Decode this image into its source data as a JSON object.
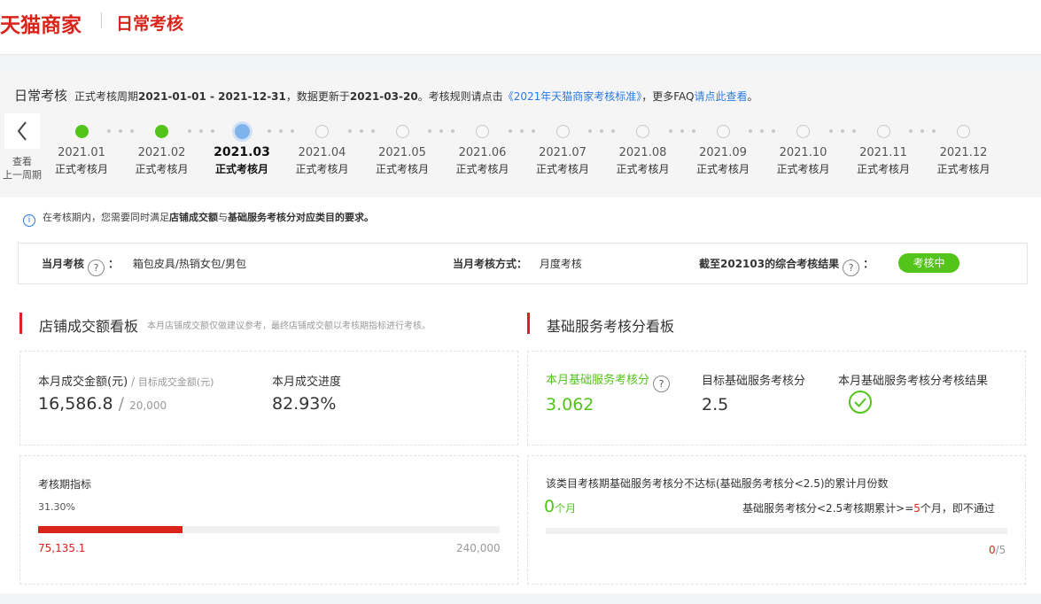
{
  "header": {
    "brand": "天猫商家",
    "title": "日常考核"
  },
  "period": {
    "title": "日常考核",
    "prefix": "正式考核周期",
    "range": "2021-01-01 - 2021-12-31",
    "update_prefix": "，数据更新于",
    "update_date": "2021-03-20",
    "rule_prefix": "。考核规则请点击",
    "rule_link": "《2021年天猫商家考核标准》",
    "faq_prefix": "，更多FAQ",
    "faq_link": "请点此查看",
    "end": "。"
  },
  "prev_button": {
    "label": "查看上一周期",
    "line1": "查看",
    "line2": "上一周期"
  },
  "months": [
    {
      "month": "2021.01",
      "status": "正式考核月",
      "state": "passed"
    },
    {
      "month": "2021.02",
      "status": "正式考核月",
      "state": "passed"
    },
    {
      "month": "2021.03",
      "status": "正式考核月",
      "state": "current"
    },
    {
      "month": "2021.04",
      "status": "正式考核月",
      "state": "future"
    },
    {
      "month": "2021.05",
      "status": "正式考核月",
      "state": "future"
    },
    {
      "month": "2021.06",
      "status": "正式考核月",
      "state": "future"
    },
    {
      "month": "2021.07",
      "status": "正式考核月",
      "state": "future"
    },
    {
      "month": "2021.08",
      "status": "正式考核月",
      "state": "future"
    },
    {
      "month": "2021.09",
      "status": "正式考核月",
      "state": "future"
    },
    {
      "month": "2021.10",
      "status": "正式考核月",
      "state": "future"
    },
    {
      "month": "2021.11",
      "status": "正式考核月",
      "state": "future"
    },
    {
      "month": "2021.12",
      "status": "正式考核月",
      "state": "future"
    }
  ],
  "info": {
    "icon": "i",
    "text1": "在考核期内，您需要同时满足",
    "bold1": "店铺成交额",
    "text2": "与",
    "bold2": "基础服务考核分对应类目的要求。"
  },
  "summary": {
    "month_label": "当月考核",
    "colon": "：",
    "category": "箱包皮具/热销女包/男包",
    "method_label": "当月考核方式：",
    "method": "月度考核",
    "result_label": "截至202103的综合考核结果",
    "result_badge": "考核中",
    "help_icon": "?"
  },
  "sales": {
    "title": "店铺成交额看板",
    "note": "本月店铺成交额仅做建议参考，最终店铺成交额以考核期指标进行考核。",
    "amount_label": "本月成交金额(元)",
    "slash": " / ",
    "target_label": "目标成交金额(元)",
    "amount": "16,586.8",
    "target": "20,000",
    "progress_label": "本月成交进度",
    "progress": "82.93%",
    "period_label": "考核期指标",
    "period_pct": "31.30%",
    "period_fraction": 0.313,
    "period_current": "75,135.1",
    "period_target": "240,000"
  },
  "service": {
    "title": "基础服务考核分看板",
    "score_label": "本月基础服务考核分",
    "score": "3.062",
    "target_label": "目标基础服务考核分",
    "target": "2.5",
    "result_label": "本月基础服务考核分考核结果",
    "fail_desc": "该类目考核期基础服务考核分不达标(基础服务考核分<2.5)的累计月份数",
    "fail_count": "0",
    "fail_unit": "个月",
    "rule_a": "基础服务考核分<2.5考核期累计>=",
    "rule_num": "5",
    "rule_b": "个月，即不通过",
    "ratio_num": "0",
    "ratio_den": "/5",
    "ratio_fraction": 0
  },
  "colors": {
    "brand": "#d9241b",
    "green": "#52c41a",
    "link": "#2c7be5",
    "active_dot": "#7fb3ec"
  }
}
